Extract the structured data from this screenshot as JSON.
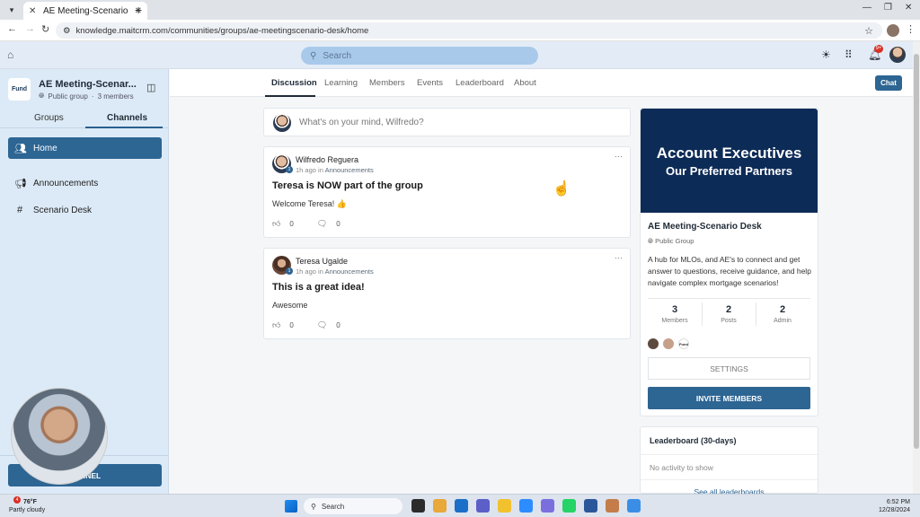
{
  "browser": {
    "tab_title": "AE Meeting-Scenario Desk",
    "url": "knowledge.maitcrm.com/communities/groups/ae-meetingscenario-desk/home"
  },
  "header": {
    "search_placeholder": "Search",
    "notification_count": "9+"
  },
  "sidebar": {
    "logo_text": "Fund",
    "group_name": "AE Meeting-Scenar...",
    "group_type": "Public group",
    "member_count": "3 members",
    "tabs": [
      {
        "label": "Groups",
        "active": false
      },
      {
        "label": "Channels",
        "active": true
      }
    ],
    "items": [
      {
        "label": "Home",
        "icon": "users-icon",
        "active": true
      },
      {
        "label": "Announcements",
        "icon": "megaphone-icon",
        "active": false
      },
      {
        "label": "Scenario Desk",
        "icon": "hash-icon",
        "active": false
      }
    ],
    "create_channel_label": "HANNEL"
  },
  "group_nav": {
    "items": [
      "Discussion",
      "Learning",
      "Members",
      "Events",
      "Leaderboard",
      "About"
    ],
    "active": "Discussion",
    "chat_label": "Chat"
  },
  "composer": {
    "placeholder": "What's on your mind, Wilfredo?"
  },
  "posts": [
    {
      "author": "Wilfredo Reguera",
      "level": "1",
      "time": "1h ago",
      "in": "in",
      "channel": "Announcements",
      "title": "Teresa is NOW part of the group",
      "body": "Welcome Teresa! 👍",
      "likes": "0",
      "comments": "0"
    },
    {
      "author": "Teresa Ugalde",
      "level": "1",
      "time": "1h ago",
      "in": "in",
      "channel": "Announcements",
      "title": "This is a great idea!",
      "body": "Awesome",
      "likes": "0",
      "comments": "0"
    }
  ],
  "group_card": {
    "banner_line1": "Account Executives",
    "banner_line2": "Our Preferred Partners",
    "name": "AE Meeting-Scenario Desk",
    "type": "Public Group",
    "description": "A hub for MLOs, and AE's to connect and get answer to questions, receive guidance, and help navigate complex mortgage scenarios!",
    "stats": [
      {
        "value": "3",
        "label": "Members"
      },
      {
        "value": "2",
        "label": "Posts"
      },
      {
        "value": "2",
        "label": "Admin"
      }
    ],
    "settings_label": "SETTINGS",
    "invite_label": "INVITE MEMBERS"
  },
  "leaderboard": {
    "title": "Leaderboard (30-days)",
    "empty_text": "No activity to show",
    "see_all": "See all leaderboards"
  },
  "taskbar": {
    "weather_temp": "76°F",
    "weather_desc": "Partly cloudy",
    "weather_badge": "4",
    "search_label": "Search",
    "time": "6:52 PM",
    "date": "12/28/2024"
  },
  "colors": {
    "accent": "#2d6593",
    "banner": "#0d2b57",
    "sidebar_bg": "#dceaf7",
    "header_bg": "#e3ecf6"
  }
}
